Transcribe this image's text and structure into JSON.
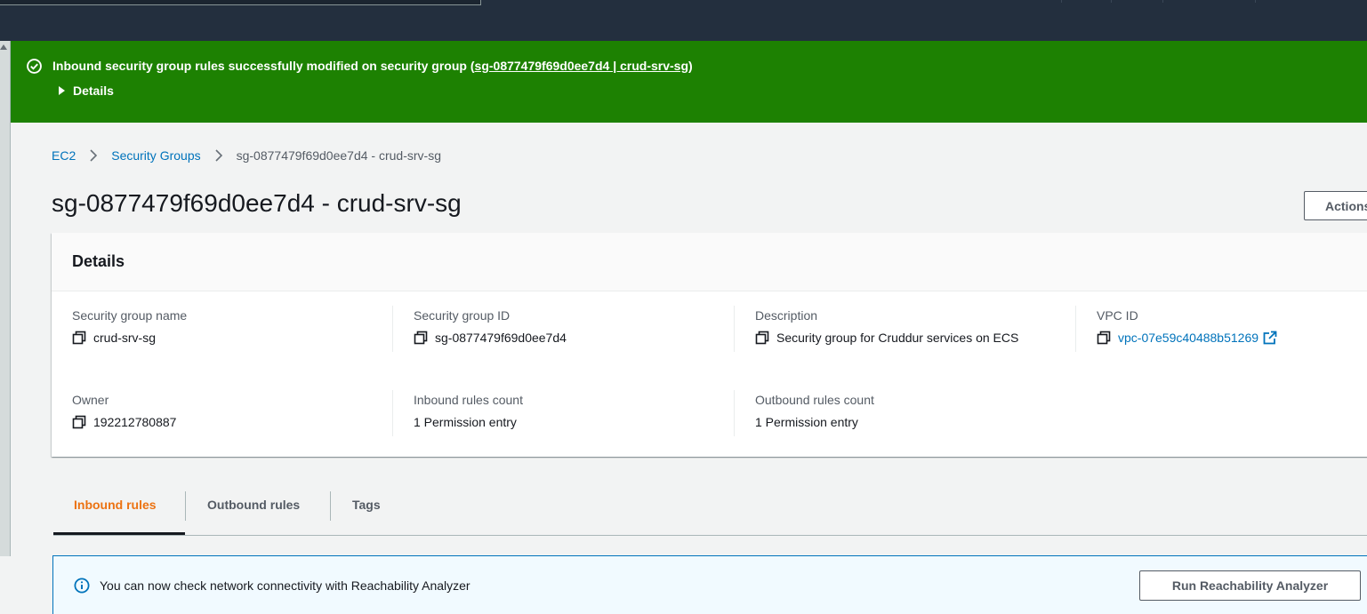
{
  "flash": {
    "message_prefix": "Inbound security group rules successfully modified on security group (",
    "message_link": "sg-0877479f69d0ee7d4 | crud-srv-sg",
    "message_suffix": ")",
    "details_label": "Details",
    "color": "#1d8102"
  },
  "breadcrumb": {
    "items": [
      "EC2",
      "Security Groups"
    ],
    "current": "sg-0877479f69d0ee7d4 - crud-srv-sg"
  },
  "page_title": "sg-0877479f69d0ee7d4 - crud-srv-sg",
  "actions_label": "Actions",
  "details": {
    "heading": "Details",
    "fields": {
      "sg_name": {
        "label": "Security group name",
        "value": "crud-srv-sg"
      },
      "sg_id": {
        "label": "Security group ID",
        "value": "sg-0877479f69d0ee7d4"
      },
      "description": {
        "label": "Description",
        "value": "Security group for Cruddur services on ECS"
      },
      "vpc_id": {
        "label": "VPC ID",
        "value": "vpc-07e59c40488b51269"
      },
      "owner": {
        "label": "Owner",
        "value": "192212780887"
      },
      "inbound_count": {
        "label": "Inbound rules count",
        "value": "1 Permission entry"
      },
      "outbound_count": {
        "label": "Outbound rules count",
        "value": "1 Permission entry"
      }
    }
  },
  "tabs": [
    {
      "label": "Inbound rules",
      "active": true
    },
    {
      "label": "Outbound rules",
      "active": false
    },
    {
      "label": "Tags",
      "active": false
    }
  ],
  "info_alert": {
    "text": "You can now check network connectivity with Reachability Analyzer",
    "button": "Run Reachability Analyzer"
  },
  "colors": {
    "link": "#0073bb",
    "active_tab": "#ec7211",
    "header_bg": "#232f3e"
  }
}
